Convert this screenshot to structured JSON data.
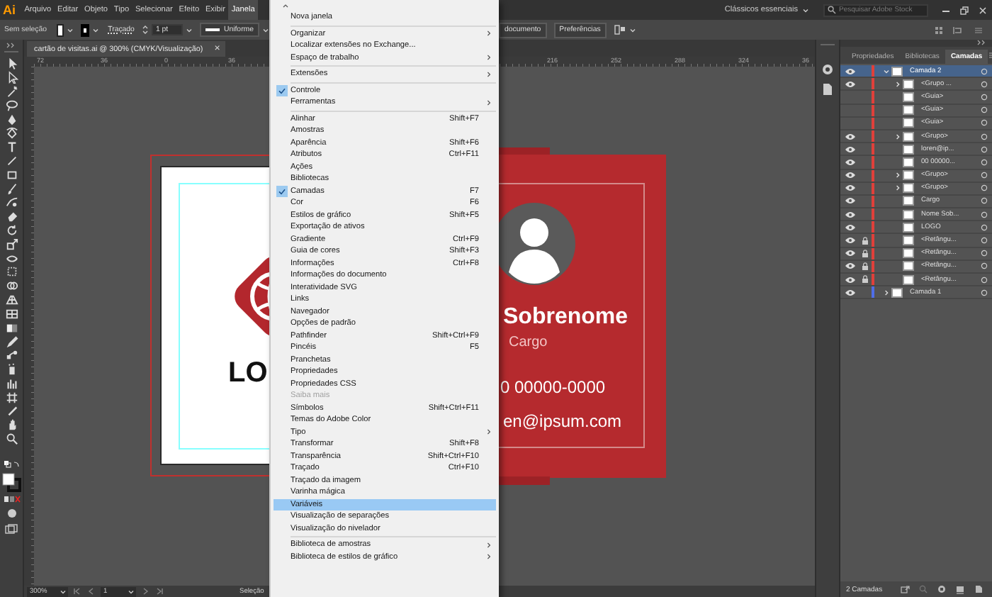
{
  "app": {
    "logo": "Ai",
    "menus": [
      {
        "label": "Arquivo",
        "selected": false
      },
      {
        "label": "Editar",
        "selected": false
      },
      {
        "label": "Objeto",
        "selected": false
      },
      {
        "label": "Tipo",
        "selected": false
      },
      {
        "label": "Selecionar",
        "selected": false
      },
      {
        "label": "Efeito",
        "selected": false
      },
      {
        "label": "Exibir",
        "selected": false
      },
      {
        "label": "Janela",
        "selected": true
      }
    ],
    "workspace": "Clássicos essenciais",
    "search": {
      "placeholder": "Pesquisar Adobe Stock"
    }
  },
  "control_bar": {
    "selection": "Sem seleção",
    "stroke_link": "Traçado",
    "stroke_weight": "1 pt",
    "stroke_profile": "Uniforme",
    "buttons": [
      "documento",
      "Preferências"
    ]
  },
  "document_tab": {
    "title": "cartão de visitas.ai @ 300% (CMYK/Visualização)",
    "close": "×"
  },
  "rulers": {
    "labels": [
      "72",
      "36",
      "0",
      "36",
      "216",
      "252",
      "288",
      "324",
      "36"
    ]
  },
  "canvas": {
    "front_card": {
      "logo_text": "LO"
    },
    "back_card": {
      "name": "Sobrenome",
      "role": "Cargo",
      "phone": "0 00000-0000",
      "email": "en@ipsum.com"
    }
  },
  "window_menu": {
    "items": [
      {
        "kind": "item",
        "label": "Nova janela",
        "checked": false,
        "submenu": false,
        "disabled": false,
        "selected": false
      },
      {
        "kind": "separator"
      },
      {
        "kind": "item",
        "label": "Organizar",
        "checked": false,
        "submenu": true,
        "disabled": false,
        "selected": false
      },
      {
        "kind": "item",
        "label": "Localizar extensões no Exchange...",
        "checked": false,
        "submenu": false,
        "disabled": false,
        "selected": false
      },
      {
        "kind": "item",
        "label": "Espaço de trabalho",
        "checked": false,
        "submenu": true,
        "disabled": false,
        "selected": false
      },
      {
        "kind": "separator"
      },
      {
        "kind": "item",
        "label": "Extensões",
        "checked": false,
        "submenu": true,
        "disabled": false,
        "selected": false
      },
      {
        "kind": "separator"
      },
      {
        "kind": "item",
        "label": "Controle",
        "checked": true,
        "submenu": false,
        "disabled": false,
        "selected": false
      },
      {
        "kind": "item",
        "label": "Ferramentas",
        "checked": false,
        "submenu": true,
        "disabled": false,
        "selected": false
      },
      {
        "kind": "separator"
      },
      {
        "kind": "item",
        "label": "Alinhar",
        "shortcut": "Shift+F7",
        "checked": false,
        "submenu": false,
        "disabled": false,
        "selected": false
      },
      {
        "kind": "item",
        "label": "Amostras",
        "checked": false,
        "submenu": false,
        "disabled": false,
        "selected": false
      },
      {
        "kind": "item",
        "label": "Aparência",
        "shortcut": "Shift+F6",
        "checked": false,
        "submenu": false,
        "disabled": false,
        "selected": false
      },
      {
        "kind": "item",
        "label": "Atributos",
        "shortcut": "Ctrl+F11",
        "checked": false,
        "submenu": false,
        "disabled": false,
        "selected": false
      },
      {
        "kind": "item",
        "label": "Ações",
        "checked": false,
        "submenu": false,
        "disabled": false,
        "selected": false
      },
      {
        "kind": "item",
        "label": "Bibliotecas",
        "checked": false,
        "submenu": false,
        "disabled": false,
        "selected": false
      },
      {
        "kind": "item",
        "label": "Camadas",
        "shortcut": "F7",
        "checked": true,
        "submenu": false,
        "disabled": false,
        "selected": false
      },
      {
        "kind": "item",
        "label": "Cor",
        "shortcut": "F6",
        "checked": false,
        "submenu": false,
        "disabled": false,
        "selected": false
      },
      {
        "kind": "item",
        "label": "Estilos de gráfico",
        "shortcut": "Shift+F5",
        "checked": false,
        "submenu": false,
        "disabled": false,
        "selected": false
      },
      {
        "kind": "item",
        "label": "Exportação de ativos",
        "checked": false,
        "submenu": false,
        "disabled": false,
        "selected": false
      },
      {
        "kind": "item",
        "label": "Gradiente",
        "shortcut": "Ctrl+F9",
        "checked": false,
        "submenu": false,
        "disabled": false,
        "selected": false
      },
      {
        "kind": "item",
        "label": "Guia de cores",
        "shortcut": "Shift+F3",
        "checked": false,
        "submenu": false,
        "disabled": false,
        "selected": false
      },
      {
        "kind": "item",
        "label": "Informações",
        "shortcut": "Ctrl+F8",
        "checked": false,
        "submenu": false,
        "disabled": false,
        "selected": false
      },
      {
        "kind": "item",
        "label": "Informações do documento",
        "checked": false,
        "submenu": false,
        "disabled": false,
        "selected": false
      },
      {
        "kind": "item",
        "label": "Interatividade SVG",
        "checked": false,
        "submenu": false,
        "disabled": false,
        "selected": false
      },
      {
        "kind": "item",
        "label": "Links",
        "checked": false,
        "submenu": false,
        "disabled": false,
        "selected": false
      },
      {
        "kind": "item",
        "label": "Navegador",
        "checked": false,
        "submenu": false,
        "disabled": false,
        "selected": false
      },
      {
        "kind": "item",
        "label": "Opções de padrão",
        "checked": false,
        "submenu": false,
        "disabled": false,
        "selected": false
      },
      {
        "kind": "item",
        "label": "Pathfinder",
        "shortcut": "Shift+Ctrl+F9",
        "checked": false,
        "submenu": false,
        "disabled": false,
        "selected": false
      },
      {
        "kind": "item",
        "label": "Pincéis",
        "shortcut": "F5",
        "checked": false,
        "submenu": false,
        "disabled": false,
        "selected": false
      },
      {
        "kind": "item",
        "label": "Pranchetas",
        "checked": false,
        "submenu": false,
        "disabled": false,
        "selected": false
      },
      {
        "kind": "item",
        "label": "Propriedades",
        "checked": false,
        "submenu": false,
        "disabled": false,
        "selected": false
      },
      {
        "kind": "item",
        "label": "Propriedades CSS",
        "checked": false,
        "submenu": false,
        "disabled": false,
        "selected": false
      },
      {
        "kind": "item",
        "label": "Saiba mais",
        "checked": false,
        "submenu": false,
        "disabled": true,
        "selected": false
      },
      {
        "kind": "item",
        "label": "Símbolos",
        "shortcut": "Shift+Ctrl+F11",
        "checked": false,
        "submenu": false,
        "disabled": false,
        "selected": false
      },
      {
        "kind": "item",
        "label": "Temas do Adobe Color",
        "checked": false,
        "submenu": false,
        "disabled": false,
        "selected": false
      },
      {
        "kind": "item",
        "label": "Tipo",
        "checked": false,
        "submenu": true,
        "disabled": false,
        "selected": false
      },
      {
        "kind": "item",
        "label": "Transformar",
        "shortcut": "Shift+F8",
        "checked": false,
        "submenu": false,
        "disabled": false,
        "selected": false
      },
      {
        "kind": "item",
        "label": "Transparência",
        "shortcut": "Shift+Ctrl+F10",
        "checked": false,
        "submenu": false,
        "disabled": false,
        "selected": false
      },
      {
        "kind": "item",
        "label": "Traçado",
        "shortcut": "Ctrl+F10",
        "checked": false,
        "submenu": false,
        "disabled": false,
        "selected": false
      },
      {
        "kind": "item",
        "label": "Traçado da imagem",
        "checked": false,
        "submenu": false,
        "disabled": false,
        "selected": false
      },
      {
        "kind": "item",
        "label": "Varinha mágica",
        "checked": false,
        "submenu": false,
        "disabled": false,
        "selected": false
      },
      {
        "kind": "item",
        "label": "Variáveis",
        "checked": false,
        "submenu": false,
        "disabled": false,
        "selected": true
      },
      {
        "kind": "item",
        "label": "Visualização de separações",
        "checked": false,
        "submenu": false,
        "disabled": false,
        "selected": false
      },
      {
        "kind": "item",
        "label": "Visualização do nivelador",
        "checked": false,
        "submenu": false,
        "disabled": false,
        "selected": false
      },
      {
        "kind": "separator"
      },
      {
        "kind": "item",
        "label": "Biblioteca de amostras",
        "checked": false,
        "submenu": true,
        "disabled": false,
        "selected": false
      },
      {
        "kind": "item",
        "label": "Biblioteca de estilos de gráfico",
        "checked": false,
        "submenu": true,
        "disabled": false,
        "selected": false
      }
    ]
  },
  "panel": {
    "tabs": [
      {
        "label": "Propriedades",
        "selected": false
      },
      {
        "label": "Bibliotecas",
        "selected": false
      },
      {
        "label": "Camadas",
        "selected": true
      }
    ],
    "layers": [
      {
        "name": "Camada 2",
        "color": "#e0403a",
        "visible": true,
        "locked": false,
        "expanded": true,
        "selected": true,
        "children": [
          {
            "name": "<Grupo ...",
            "visible": true,
            "locked": false,
            "expanded": false,
            "selected": false
          },
          {
            "name": "<Guia>",
            "visible": false,
            "locked": false,
            "selected": false
          },
          {
            "name": "<Guia>",
            "visible": false,
            "locked": false,
            "selected": false
          },
          {
            "name": "<Guia>",
            "visible": false,
            "locked": false,
            "selected": false
          },
          {
            "name": "<Grupo>",
            "visible": true,
            "locked": false,
            "expanded": false,
            "selected": false
          },
          {
            "name": "loren@ip...",
            "visible": true,
            "locked": false,
            "selected": false
          },
          {
            "name": "00 00000...",
            "visible": true,
            "locked": false,
            "selected": false
          },
          {
            "name": "<Grupo>",
            "visible": true,
            "locked": false,
            "expanded": false,
            "selected": false
          },
          {
            "name": "<Grupo>",
            "visible": true,
            "locked": false,
            "expanded": false,
            "selected": false
          },
          {
            "name": "Cargo",
            "visible": true,
            "locked": false,
            "selected": false
          },
          {
            "name": "Nome Sob...",
            "visible": true,
            "locked": false,
            "selected": false
          },
          {
            "name": "LOGO",
            "visible": true,
            "locked": false,
            "selected": false
          },
          {
            "name": "<Retângu...",
            "visible": true,
            "locked": true,
            "selected": false
          },
          {
            "name": "<Retângu...",
            "visible": true,
            "locked": true,
            "selected": false
          },
          {
            "name": "<Retângu...",
            "visible": true,
            "locked": true,
            "selected": false
          },
          {
            "name": "<Retângu...",
            "visible": true,
            "locked": true,
            "selected": false
          }
        ]
      },
      {
        "name": "Camada 1",
        "color": "#4f6ee8",
        "visible": true,
        "locked": false,
        "expanded": false,
        "selected": false
      }
    ],
    "footer": "2 Camadas"
  },
  "status_bar": {
    "zoom": "300%",
    "artboard": "1",
    "tool": "Seleção"
  }
}
